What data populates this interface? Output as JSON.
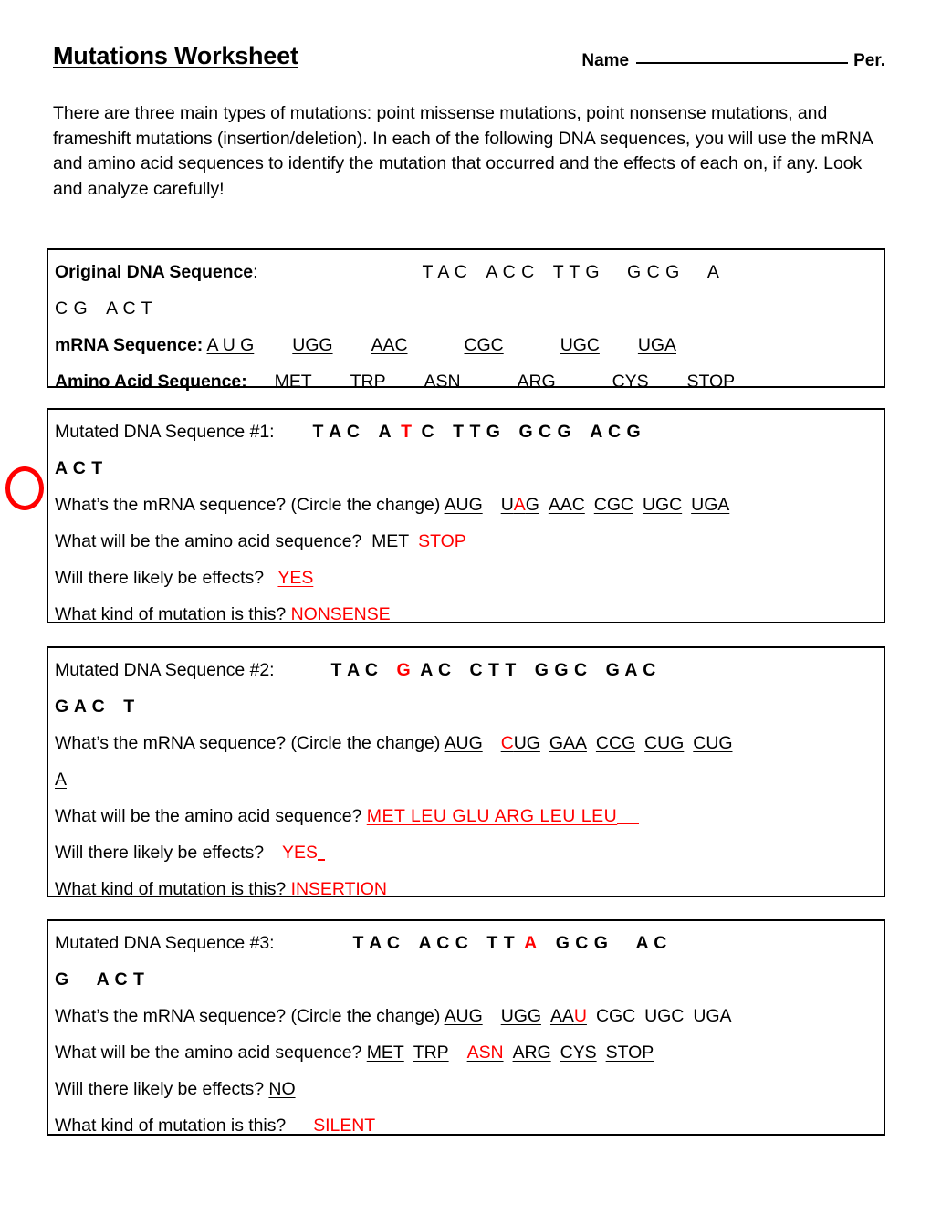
{
  "header": {
    "title": "Mutations Worksheet",
    "name_label": "Name",
    "period_label": "Per."
  },
  "intro": {
    "text": "There are three main types of mutations: point missense mutations, point nonsense mutations, and frameshift mutations (insertion/deletion).  In each of the following DNA sequences, you will use the mRNA and amino acid sequences to identify the mutation that occurred and the effects of each on, if any.  Look and analyze carefully!"
  },
  "original": {
    "dna_label": "Original DNA Sequence",
    "dna_colon": ":",
    "dna_line1_a": "T A C",
    "dna_line1_b": "A C C",
    "dna_line1_c": "T T G",
    "dna_line1_d": "G C G",
    "dna_line1_e": "A",
    "dna_line2_a": "C G",
    "dna_line2_b": "A C T",
    "mrna_label": "mRNA Sequence:",
    "mrna_codons": [
      "A U G",
      "UGG",
      "AAC",
      "CGC",
      "UGC",
      "UGA"
    ],
    "amino_label": "Amino Acid Sequence:",
    "amino_values": [
      "MET",
      "TRP",
      "ASN",
      "ARG",
      "CYS",
      "STOP"
    ]
  },
  "mutations": [
    {
      "dna_label": "Mutated DNA Sequence #1:",
      "dna_line1": [
        {
          "t": "T A C",
          "red": false
        },
        {
          "t": "A",
          "red": false
        },
        {
          "t": "T",
          "red": true
        },
        {
          "t": "C",
          "red": false
        },
        {
          "t": "T T G",
          "red": false
        },
        {
          "t": "G C G",
          "red": false
        },
        {
          "t": "A C G",
          "red": false
        }
      ],
      "dna_line2": "A C T",
      "q_mrna": "What’s the mRNA sequence? (Circle the change)",
      "mrna_answer": [
        {
          "t": "AUG",
          "red": false
        },
        {
          "t": "U",
          "red": false
        },
        {
          "t": "A",
          "red": true
        },
        {
          "t": "G",
          "red": false
        },
        {
          "t": "AAC",
          "red": false
        },
        {
          "t": "CGC",
          "red": false
        },
        {
          "t": "UGC",
          "red": false
        },
        {
          "t": "UGA",
          "red": false
        }
      ],
      "q_amino": "What will be the amino acid sequence?",
      "amino_answer_black": "MET",
      "amino_answer_red": "STOP",
      "q_effects": "Will there likely be effects?",
      "effects_answer": "YES",
      "q_kind": "What kind of mutation is this?",
      "kind_answer": "NONSENSE"
    },
    {
      "dna_label": "Mutated DNA Sequence #2:",
      "dna_line1": [
        {
          "t": "T A C",
          "red": false
        },
        {
          "t": "G",
          "red": true
        },
        {
          "t": "A C",
          "red": false
        },
        {
          "t": "C T T",
          "red": false
        },
        {
          "t": "G G C",
          "red": false
        },
        {
          "t": "G A C",
          "red": false
        }
      ],
      "dna_line2_a": "G A C",
      "dna_line2_b": "T",
      "q_mrna": "What’s the mRNA sequence? (Circle the change)",
      "mrna_answer": [
        {
          "t": "AUG",
          "red": false
        },
        {
          "t": "C",
          "red": true
        },
        {
          "t": "UG",
          "red": false
        },
        {
          "t": "GAA",
          "red": false
        },
        {
          "t": "CCG",
          "red": false
        },
        {
          "t": "CUG",
          "red": false
        },
        {
          "t": "CUG",
          "red": false
        }
      ],
      "mrna_wrap": "A",
      "q_amino": "What will be the amino acid sequence?",
      "amino_answer": "MET   LEU   GLU   ARG   LEU   LEU",
      "q_effects": "Will there likely be effects?",
      "effects_answer": "YES",
      "q_kind": "What kind of mutation is this?",
      "kind_answer": "INSERTION"
    },
    {
      "dna_label": "Mutated DNA Sequence #3:",
      "dna_line1": [
        {
          "t": "T A C",
          "red": false
        },
        {
          "t": "A C C",
          "red": false
        },
        {
          "t": "T T",
          "red": false
        },
        {
          "t": "A",
          "red": true
        },
        {
          "t": "G C G",
          "red": false
        },
        {
          "t": "A C",
          "red": false
        }
      ],
      "dna_line2_a": "G",
      "dna_line2_b": "A C T",
      "q_mrna": "What’s the mRNA sequence? (Circle the change)",
      "mrna_underlined": [
        {
          "t": "AUG",
          "red": false
        },
        {
          "t": "UGG",
          "red": false
        },
        {
          "t": "AA",
          "red": false
        },
        {
          "t": "U",
          "red": true
        }
      ],
      "mrna_plain": [
        "CGC",
        "UGC",
        "UGA"
      ],
      "q_amino": "What will be the amino acid sequence?",
      "amino_answer": [
        {
          "t": "MET",
          "red": false
        },
        {
          "t": "TRP",
          "red": false
        },
        {
          "t": "ASN",
          "red": true
        },
        {
          "t": "ARG",
          "red": false
        },
        {
          "t": "CYS",
          "red": false
        },
        {
          "t": "STOP",
          "red": false
        }
      ],
      "q_effects": "Will there likely be effects?",
      "effects_answer": "NO",
      "q_kind": "What kind of mutation is this?",
      "kind_answer": "SILENT"
    }
  ],
  "annotation": {
    "circle": "red-circle-mark"
  },
  "colors": {
    "accent_red": "#ff0000",
    "text": "#000000"
  }
}
